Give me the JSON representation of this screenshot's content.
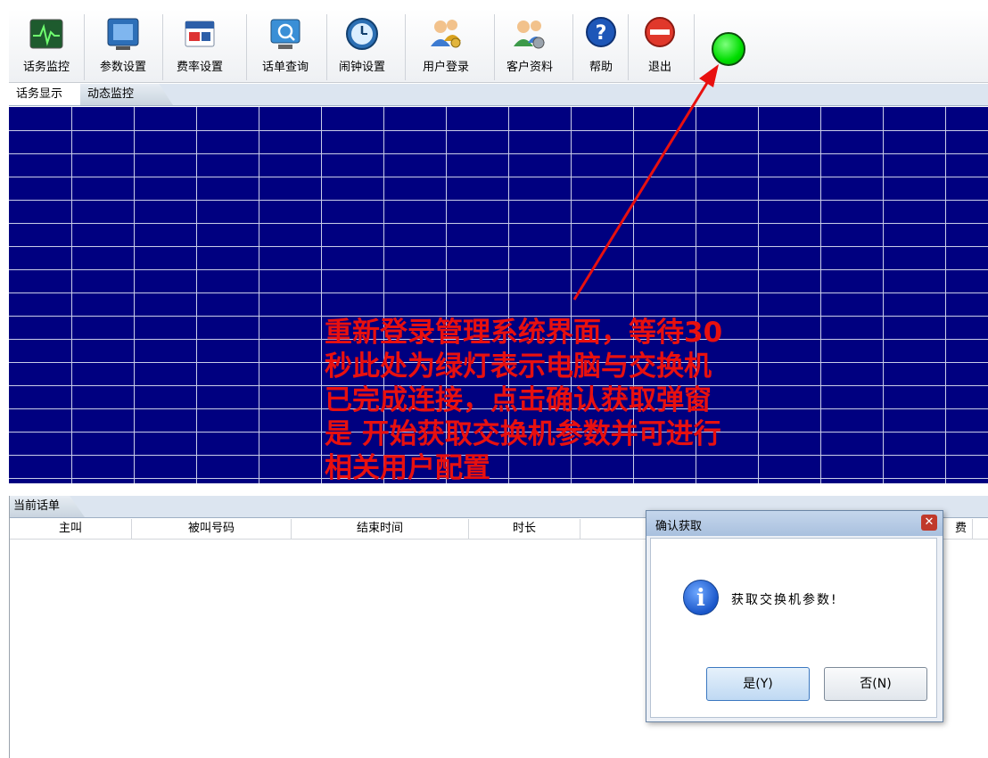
{
  "toolbar": {
    "buttons": [
      {
        "label": "话务监控",
        "icon": "traffic-monitor-icon"
      },
      {
        "label": "参数设置",
        "icon": "parameter-settings-icon"
      },
      {
        "label": "费率设置",
        "icon": "rate-settings-icon"
      },
      {
        "label": "话单查询",
        "icon": "call-record-query-icon"
      },
      {
        "label": "闹钟设置",
        "icon": "alarm-clock-icon"
      },
      {
        "label": "用户登录",
        "icon": "user-login-icon"
      },
      {
        "label": "客户资料",
        "icon": "customer-data-icon"
      },
      {
        "label": "帮助",
        "icon": "help-icon"
      },
      {
        "label": "退出",
        "icon": "exit-icon"
      }
    ],
    "status_led_color": "#00dd00"
  },
  "tabs": {
    "monitor": "话务显示",
    "dynamic": "动态监控"
  },
  "calls_panel": {
    "tab": "当前话单",
    "columns": [
      "主叫",
      "被叫号码",
      "结束时间",
      "时长",
      "费"
    ]
  },
  "dialog": {
    "title": "确认获取",
    "message": "获取交换机参数!",
    "yes_label": "是(Y)",
    "no_label": "否(N)"
  },
  "annotation": {
    "lines": [
      "重新登录管理系统界面，等待30",
      "秒此处为绿灯表示电脑与交换机",
      "已完成连接，点击确认获取弹窗",
      "是 开始获取交换机参数并可进行",
      "相关用户配置"
    ],
    "color": "#e8100f"
  }
}
